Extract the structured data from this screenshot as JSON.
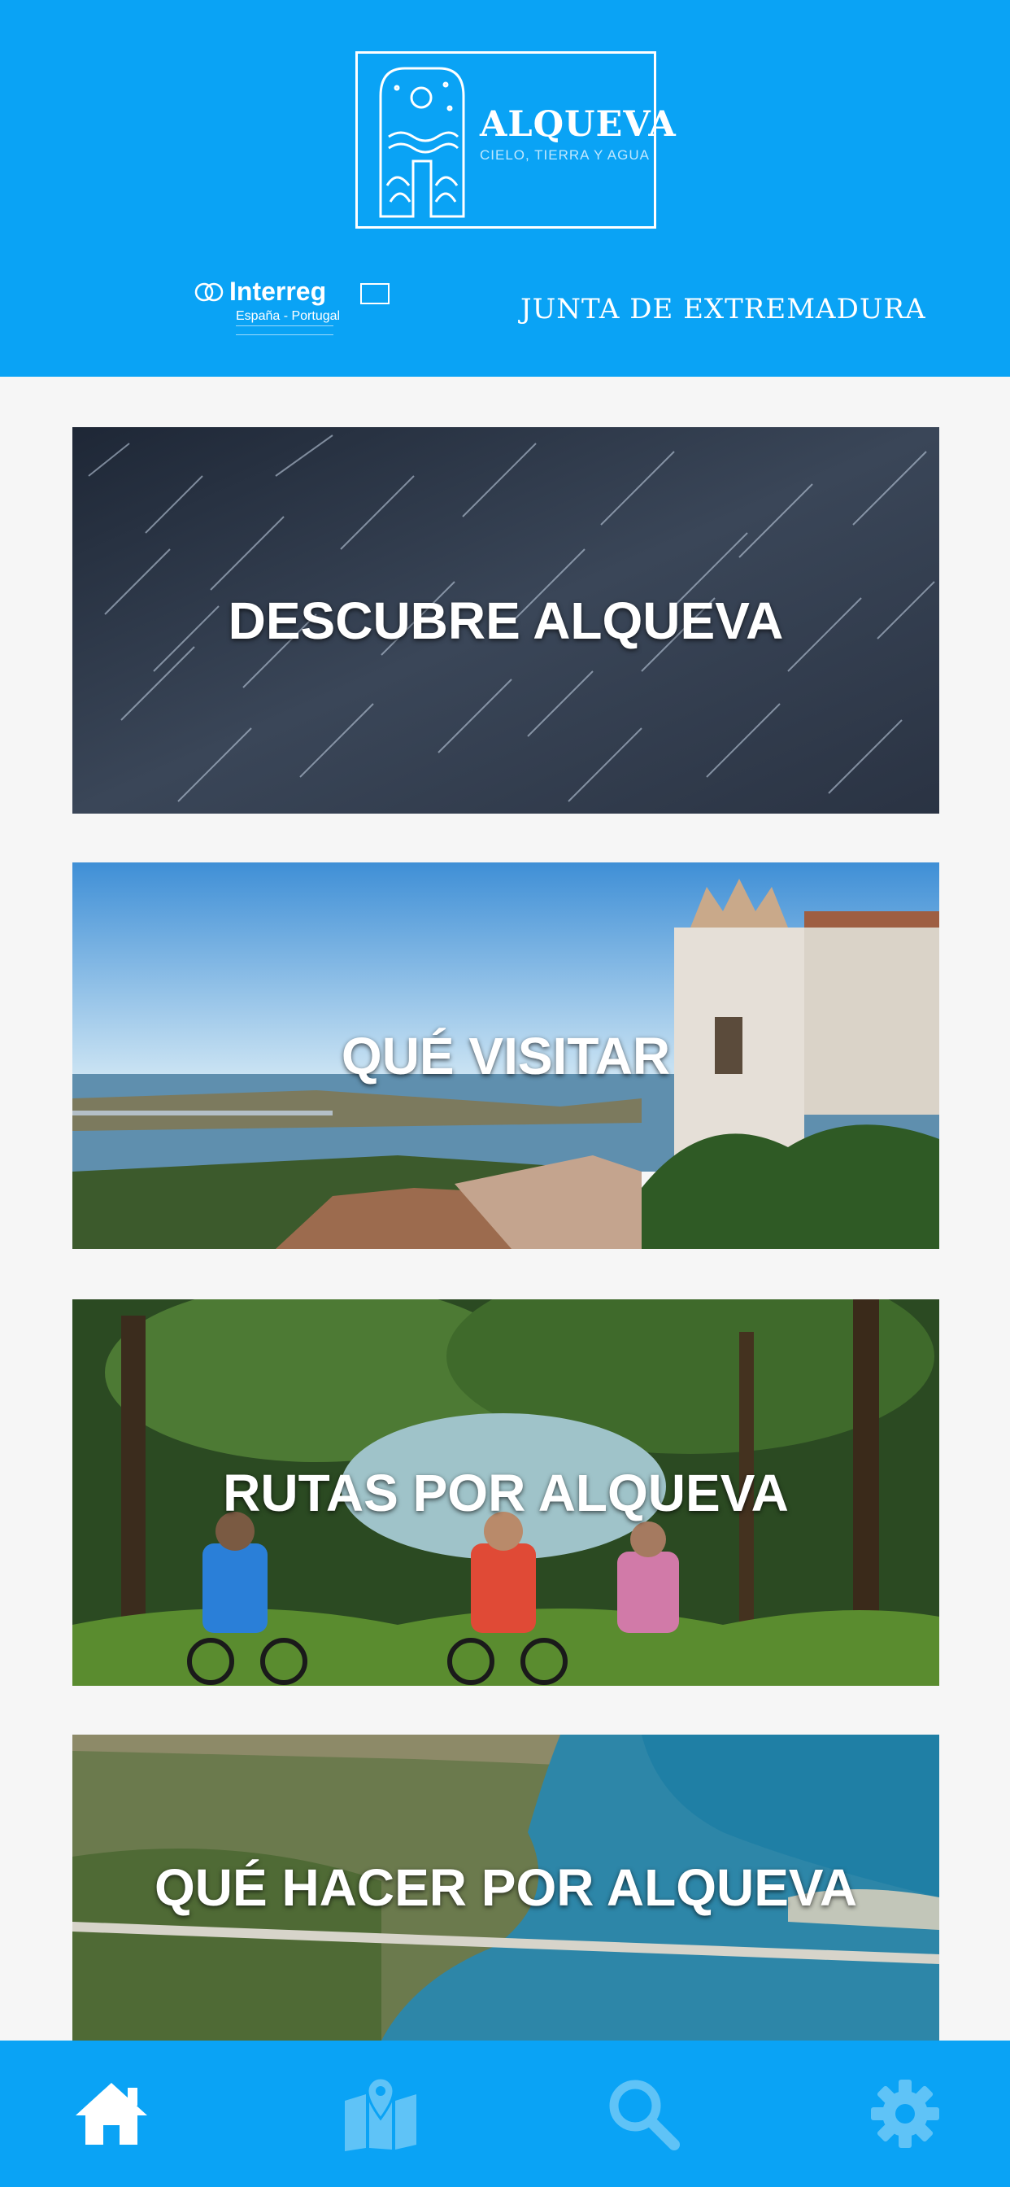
{
  "header": {
    "logo": {
      "title": "ALQUEVA",
      "subtitle": "CIELO, TIERRA Y AGUA"
    },
    "partners": {
      "interreg_name": "Interreg",
      "interreg_country": "España - Portugal",
      "junta": "JUNTA DE EXTREMADURA"
    }
  },
  "cards": [
    {
      "label": "DESCUBRE ALQUEVA"
    },
    {
      "label": "QUÉ VISITAR"
    },
    {
      "label": "RUTAS POR ALQUEVA"
    },
    {
      "label": "QUÉ HACER POR ALQUEVA"
    }
  ],
  "bottom_nav": {
    "items": [
      {
        "icon": "home-icon",
        "color": "#ffffff",
        "active": true
      },
      {
        "icon": "map-icon",
        "color": "#5fc3f7",
        "active": false
      },
      {
        "icon": "search-icon",
        "color": "#5fc3f7",
        "active": false
      },
      {
        "icon": "gear-icon",
        "color": "#5fc3f7",
        "active": false
      }
    ]
  },
  "colors": {
    "brand_blue": "#0aa3f5",
    "background": "#f6f6f6",
    "inactive_icon": "#5fc3f7"
  }
}
